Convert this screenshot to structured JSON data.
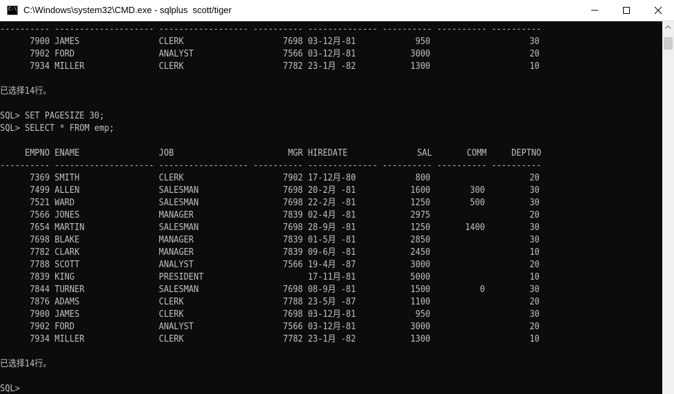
{
  "window": {
    "title": "C:\\Windows\\system32\\CMD.exe - sqlplus  scott/tiger",
    "icon": "cmd-icon",
    "icon_text": "C:\\"
  },
  "console": {
    "lines": [
      "---------- -------------------- ------------------ ---------- -------------- ---------- ---------- ----------",
      "      7900 JAMES                CLERK                    7698 03-12月-81            950                    30",
      "      7902 FORD                 ANALYST                  7566 03-12月-81           3000                    20",
      "      7934 MILLER               CLERK                    7782 23-1月 -82           1300                    10",
      "",
      "已选择14行。",
      "",
      "SQL> SET PAGESIZE 30;",
      "SQL> SELECT * FROM emp;",
      "",
      "     EMPNO ENAME                JOB                       MGR HIREDATE              SAL       COMM     DEPTNO",
      "---------- -------------------- ------------------ ---------- -------------- ---------- ---------- ----------",
      "      7369 SMITH                CLERK                    7902 17-12月-80            800                    20",
      "      7499 ALLEN                SALESMAN                 7698 20-2月 -81           1600        300         30",
      "      7521 WARD                 SALESMAN                 7698 22-2月 -81           1250        500         30",
      "      7566 JONES                MANAGER                  7839 02-4月 -81           2975                    20",
      "      7654 MARTIN               SALESMAN                 7698 28-9月 -81           1250       1400         30",
      "      7698 BLAKE                MANAGER                  7839 01-5月 -81           2850                    30",
      "      7782 CLARK                MANAGER                  7839 09-6月 -81           2450                    10",
      "      7788 SCOTT                ANALYST                  7566 19-4月 -87           3000                    20",
      "      7839 KING                 PRESIDENT                     17-11月-81           5000                    10",
      "      7844 TURNER               SALESMAN                 7698 08-9月 -81           1500          0         30",
      "      7876 ADAMS                CLERK                    7788 23-5月 -87           1100                    20",
      "      7900 JAMES                CLERK                    7698 03-12月-81            950                    30",
      "      7902 FORD                 ANALYST                  7566 03-12月-81           3000                    20",
      "      7934 MILLER               CLERK                    7782 23-1月 -82           1300                    10",
      "",
      "已选择14行。",
      "",
      "SQL>"
    ]
  },
  "colors": {
    "background": "#0c0c0c",
    "text": "#c0c0c0"
  }
}
